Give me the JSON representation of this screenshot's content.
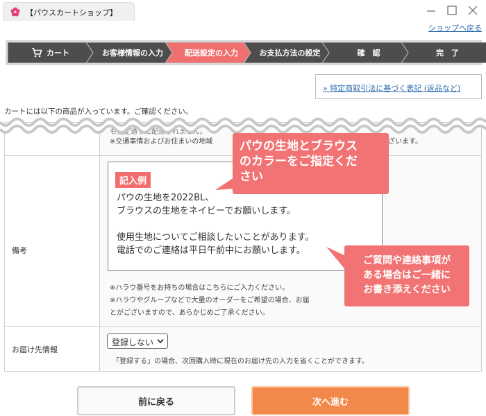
{
  "window": {
    "tab_title": "【パウスカートショップ】",
    "back_to_shop": "ショップへ戻る"
  },
  "steps": [
    {
      "label": "カート",
      "active": false
    },
    {
      "label": "お客様情報の入力",
      "active": false
    },
    {
      "label": "配送設定の入力",
      "active": true
    },
    {
      "label": "お支払方法の設定",
      "active": false
    },
    {
      "label": "確　認",
      "active": false
    },
    {
      "label": "完　了",
      "active": false
    }
  ],
  "colors": {
    "step_inactive": "#4d4d4d",
    "step_active": "#f07070",
    "callout": "#f27373",
    "next_button": "#f2884a",
    "link": "#2b6cb0"
  },
  "legal_link": "» 特定商取引法に基づく表記 (返品など)",
  "cart_note": "カートには以下の商品が入っています。ご確認ください。",
  "delivery": {
    "faded_line": "も指定通りに配達されません。",
    "transport_note": "※交通事情およびお住まいの地域",
    "transport_note_tail": "ざいます。"
  },
  "remarks": {
    "label": "備考",
    "example_badge": "記入例",
    "lines": [
      "パウの生地を2022BL、",
      "ブラウスの生地をネイビーでお願いします。",
      "",
      "使用生地についてご相談したいことがあります。",
      "電話でのご連絡は平日午前中にお願いします。"
    ],
    "hints": [
      "※ハラウ番号をお持ちの場合はこちらにご入力ください。",
      "※ハラウやグループなどで大量のオーダーをご希望の場合、お届",
      "とがございますので、あらかじめご了承ください。"
    ]
  },
  "address": {
    "label": "お届け先情報",
    "select_value": "登録しない",
    "note": "「登録する」の場合、次回購入時に現在のお届け先の入力を省くことができます。"
  },
  "callouts": {
    "fabric": [
      "パウの生地とブラウス",
      "のカラーをご指定くだ",
      "さい"
    ],
    "questions": [
      "ご質問や連絡事項が",
      "ある場合はご一緒に",
      "お書き添えください"
    ]
  },
  "buttons": {
    "back": "前に戻る",
    "next": "次へ進む"
  }
}
